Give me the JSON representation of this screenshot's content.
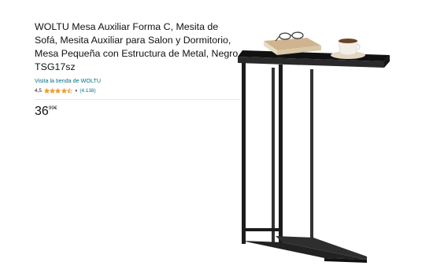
{
  "product": {
    "title": "WOLTU Mesa Auxiliar Forma C, Mesita de Sofá, Mesita Auxiliar para Salon y Dormitorio, Mesa Pequeña con Estructura de Metal, Negro, TSG17sz",
    "store_link": "Visita la tienda de WOLTU",
    "rating_value": "4,5",
    "rating_stars": 4.5,
    "rating_count": "(4.138)",
    "price_whole": "36",
    "price_fraction": "99",
    "price_currency": "€"
  },
  "colors": {
    "link": "#007185",
    "star": "#f6a41b",
    "table_black": "#1c1c1c"
  },
  "icons": {
    "rating_dropdown": "chevron-down-icon"
  }
}
